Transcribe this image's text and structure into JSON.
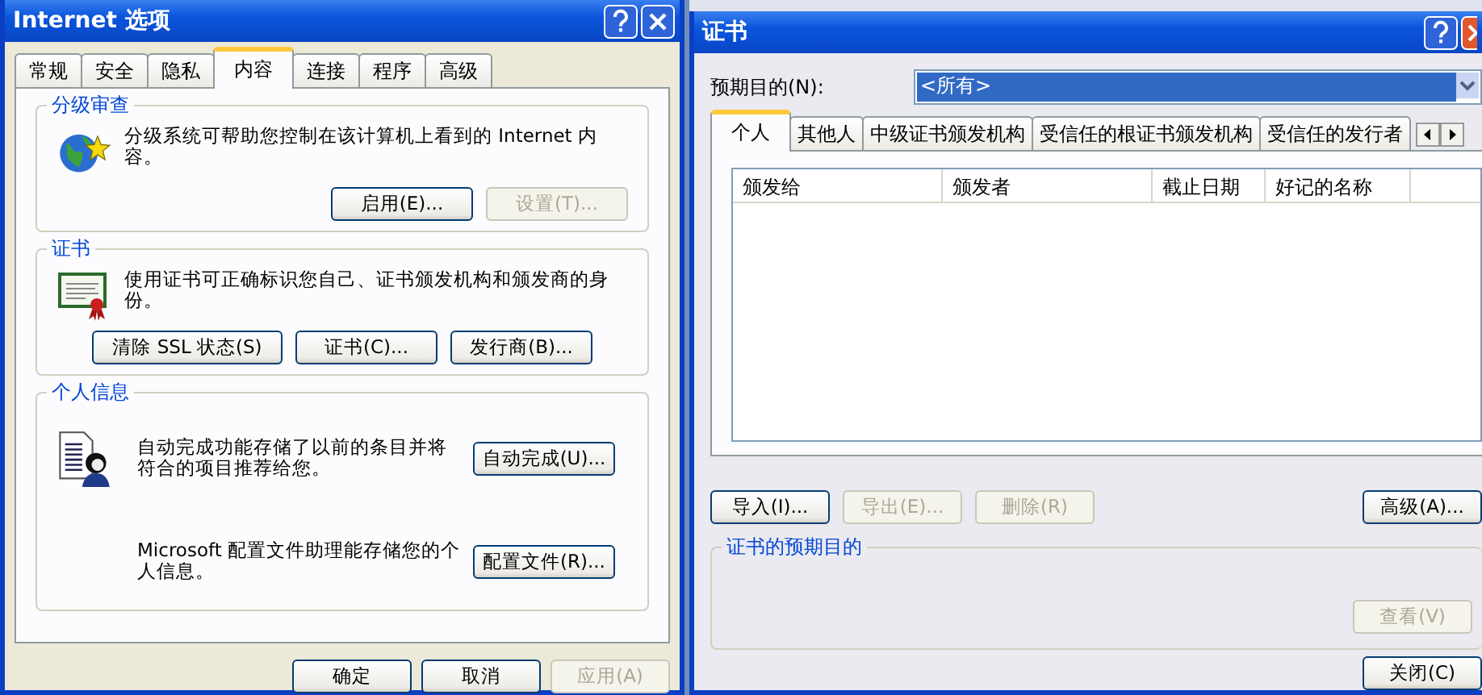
{
  "options_dialog": {
    "title": "Internet 选项",
    "tabs": [
      {
        "label": "常规",
        "selected": false
      },
      {
        "label": "安全",
        "selected": false
      },
      {
        "label": "隐私",
        "selected": false
      },
      {
        "label": "内容",
        "selected": true
      },
      {
        "label": "连接",
        "selected": false
      },
      {
        "label": "程序",
        "selected": false
      },
      {
        "label": "高级",
        "selected": false
      }
    ],
    "groups": [
      {
        "kind": "rating",
        "title": "分级审查",
        "text": "分级系统可帮助您控制在该计算机上看到的 Internet 内容。",
        "buttons": [
          {
            "label": "启用(E)...",
            "disabled": false
          },
          {
            "label": "设置(T)...",
            "disabled": true
          }
        ]
      },
      {
        "kind": "certificate",
        "title": "证书",
        "text": "使用证书可正确标识您自己、证书颁发机构和颁发商的身份。",
        "buttons": [
          {
            "label": "清除 SSL 状态(S)",
            "disabled": false
          },
          {
            "label": "证书(C)...",
            "disabled": false
          },
          {
            "label": "发行商(B)...",
            "disabled": false
          }
        ]
      },
      {
        "kind": "personal",
        "title": "个人信息",
        "rows": [
          {
            "text": "自动完成功能存储了以前的条目并将符合的项目推荐给您。",
            "button": "自动完成(U)..."
          },
          {
            "text": "Microsoft 配置文件助理能存储您的个人信息。",
            "button": "配置文件(R)..."
          }
        ]
      }
    ],
    "footer_buttons": [
      {
        "label": "确定",
        "disabled": false
      },
      {
        "label": "取消",
        "disabled": false
      },
      {
        "label": "应用(A)",
        "disabled": true
      }
    ]
  },
  "certificates_dialog": {
    "title": "证书",
    "purpose_label": "预期目的(N):",
    "purpose_value": "<所有>",
    "tabs": [
      {
        "label": "个人",
        "selected": true
      },
      {
        "label": "其他人",
        "selected": false
      },
      {
        "label": "中级证书颁发机构",
        "selected": false
      },
      {
        "label": "受信任的根证书颁发机构",
        "selected": false
      },
      {
        "label": "受信任的发行者",
        "selected": false
      }
    ],
    "columns": [
      "颁发给",
      "颁发者",
      "截止日期",
      "好记的名称"
    ],
    "buttons": [
      {
        "label": "导入(I)...",
        "disabled": false
      },
      {
        "label": "导出(E)...",
        "disabled": true
      },
      {
        "label": "删除(R)",
        "disabled": true
      }
    ],
    "advanced_button": {
      "label": "高级(A)...",
      "disabled": false
    },
    "purpose_group": "证书的预期目的",
    "view_button": {
      "label": "查看(V)",
      "disabled": true
    },
    "close_button": {
      "label": "关闭(C)",
      "disabled": false
    }
  }
}
